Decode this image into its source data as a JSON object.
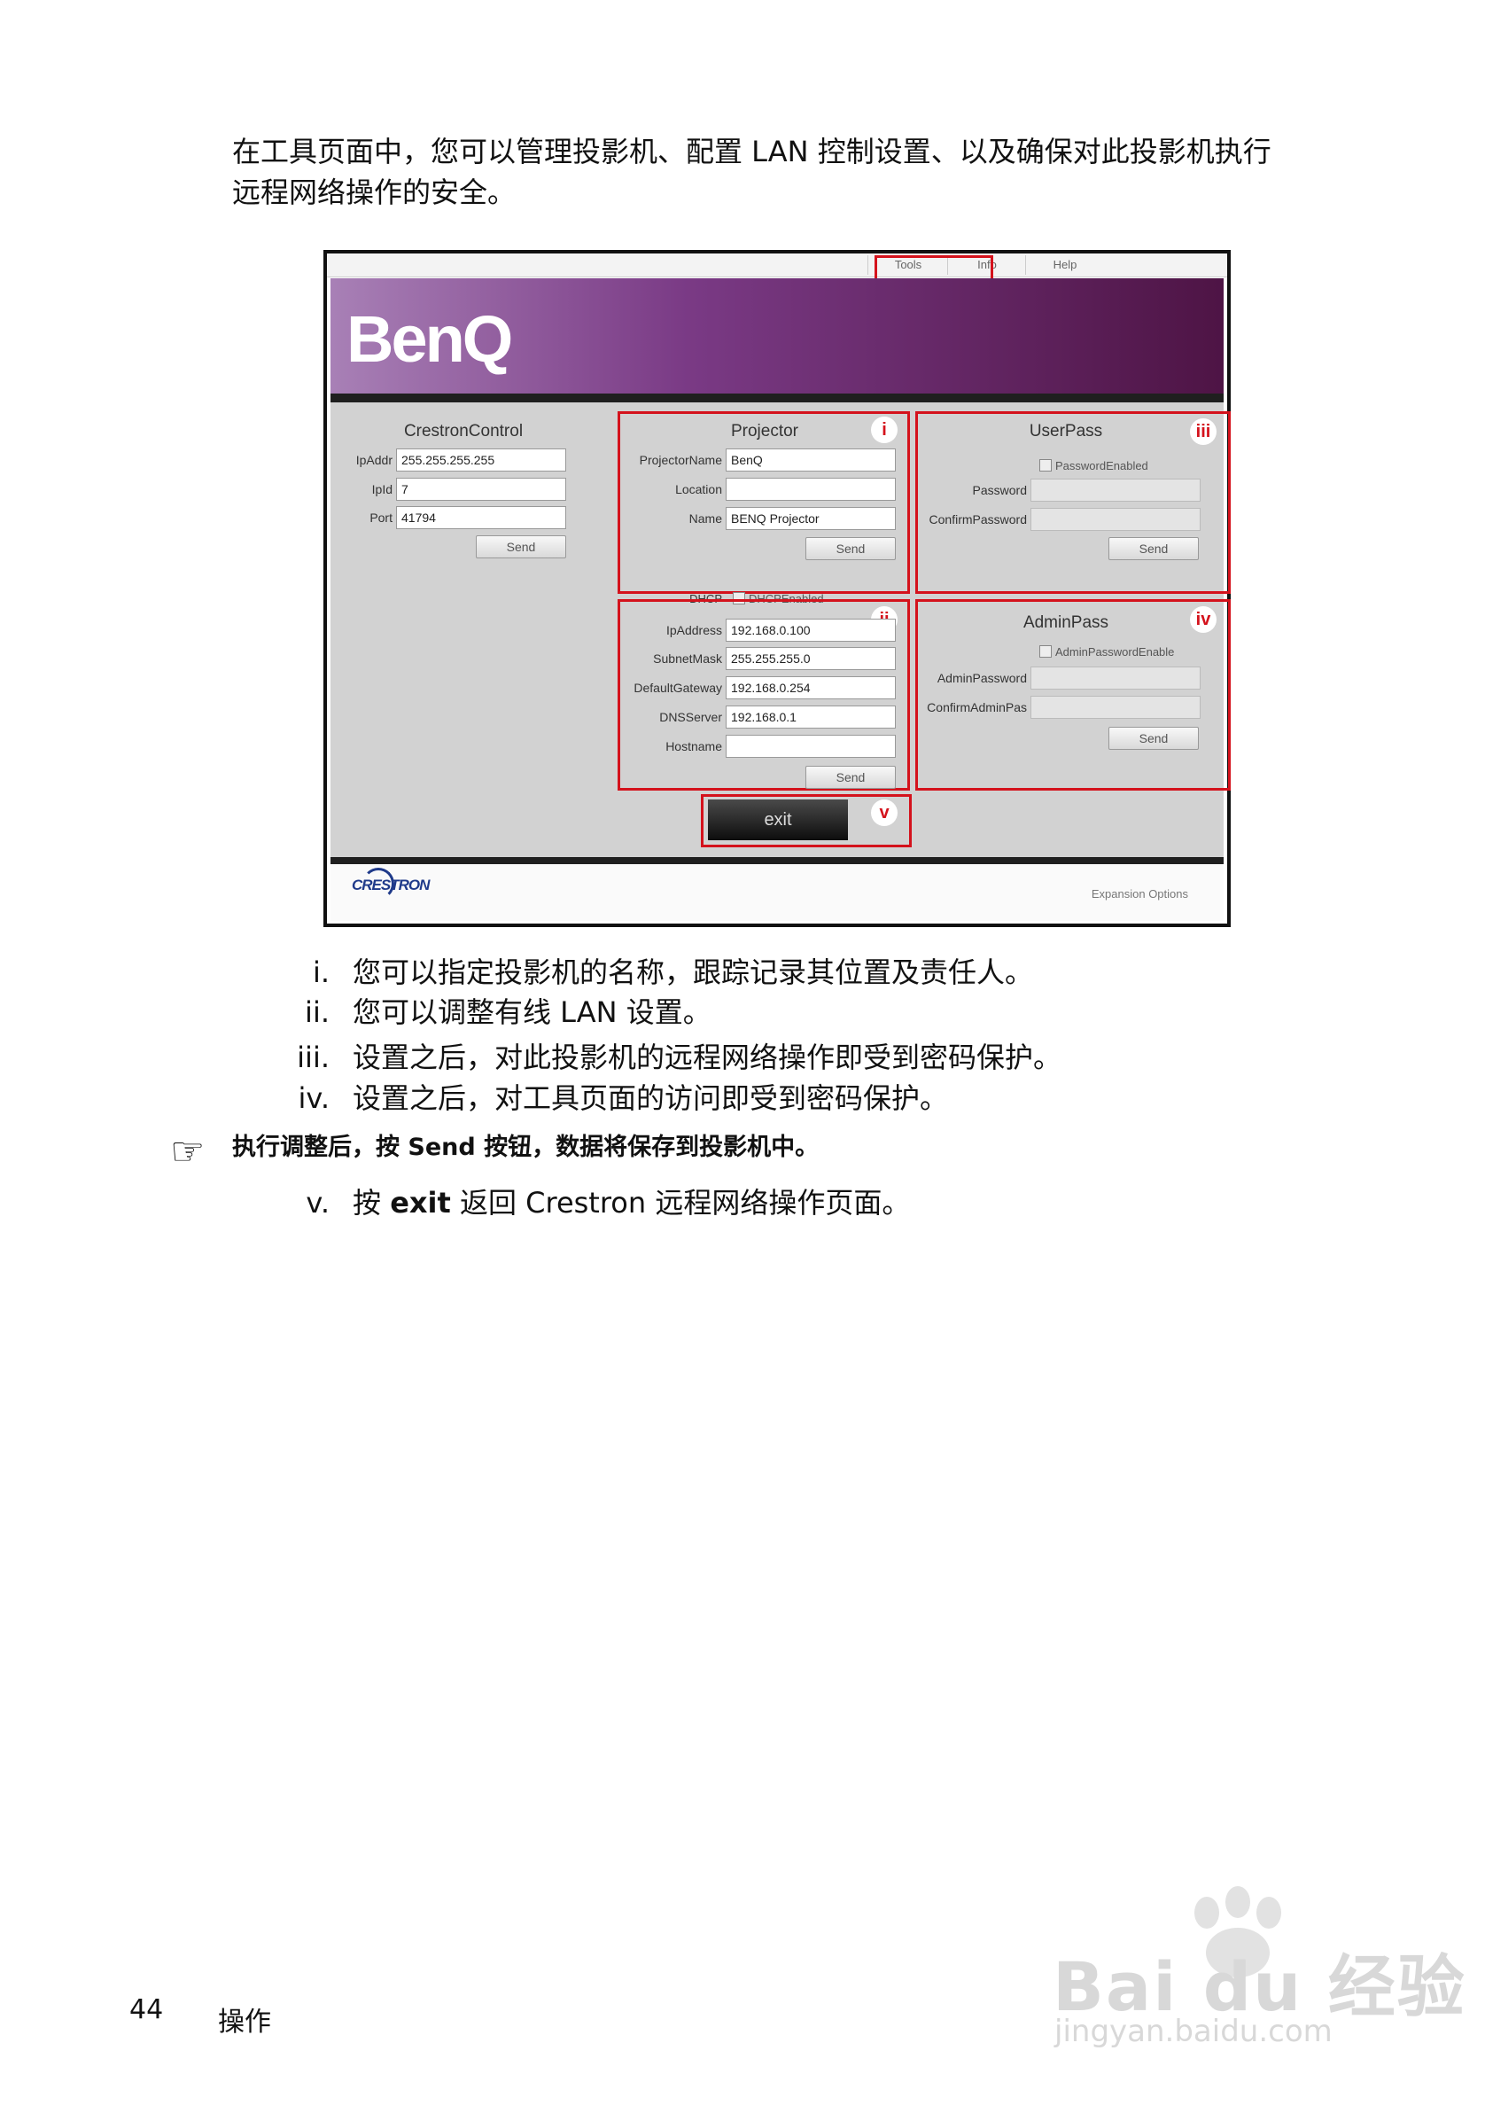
{
  "intro": {
    "line1": "在工具页面中，您可以管理投影机、配置 LAN 控制设置、以及确保对此投影机执行",
    "line2": "远程网络操作的安全。"
  },
  "screenshot": {
    "nav": {
      "tools": "Tools",
      "info": "Info",
      "help": "Help"
    },
    "logo": "BenQ",
    "crestron_control": {
      "title": "CrestronControl",
      "ipaddr_label": "IpAddr",
      "ipaddr_value": "255.255.255.255",
      "ipid_label": "IpId",
      "ipid_value": "7",
      "port_label": "Port",
      "port_value": "41794",
      "send": "Send"
    },
    "projector": {
      "title": "Projector",
      "name_label": "ProjectorName",
      "name_value": "BenQ",
      "location_label": "Location",
      "location_value": "",
      "name2_label": "Name",
      "name2_value": "BENQ Projector",
      "send": "Send",
      "badge": "i"
    },
    "dhcp": {
      "label": "DHCP",
      "check_label": "DHCPEnabled"
    },
    "network": {
      "ip_label": "IpAddress",
      "ip_value": "192.168.0.100",
      "mask_label": "SubnetMask",
      "mask_value": "255.255.255.0",
      "gw_label": "DefaultGateway",
      "gw_value": "192.168.0.254",
      "dns_label": "DNSServer",
      "dns_value": "192.168.0.1",
      "host_label": "Hostname",
      "host_value": "",
      "send": "Send",
      "badge": "ii"
    },
    "userpass": {
      "title": "UserPass",
      "check_label": "PasswordEnabled",
      "pw_label": "Password",
      "confirm_label": "ConfirmPassword",
      "send": "Send",
      "badge": "iii"
    },
    "adminpass": {
      "title": "AdminPass",
      "check_label": "AdminPasswordEnable",
      "pw_label": "AdminPassword",
      "confirm_label": "ConfirmAdminPas",
      "send": "Send",
      "badge": "iv"
    },
    "exit": {
      "label": "exit",
      "badge": "v"
    },
    "footer": {
      "brand": "CRESTRON",
      "expansion": "Expansion Options"
    }
  },
  "list": [
    {
      "num": "i.",
      "text": "您可以指定投影机的名称，跟踪记录其位置及责任人。"
    },
    {
      "num": "ii.",
      "text": "您可以调整有线 LAN 设置。"
    },
    {
      "num": "iii.",
      "text": "设置之后，对此投影机的远程网络操作即受到密码保护。"
    },
    {
      "num": "iv.",
      "text": "设置之后，对工具页面的访问即受到密码保护。"
    }
  ],
  "note": "执行调整后，按 Send 按钮，数据将保存到投影机中。",
  "item_v": {
    "num": "v.",
    "pre": "按 ",
    "bold": "exit",
    "post": " 返回 Crestron 远程网络操作页面。"
  },
  "page": {
    "number": "44",
    "section": "操作"
  },
  "watermark": {
    "brand": "Bai du 经验",
    "url": "jingyan.baidu.com"
  }
}
